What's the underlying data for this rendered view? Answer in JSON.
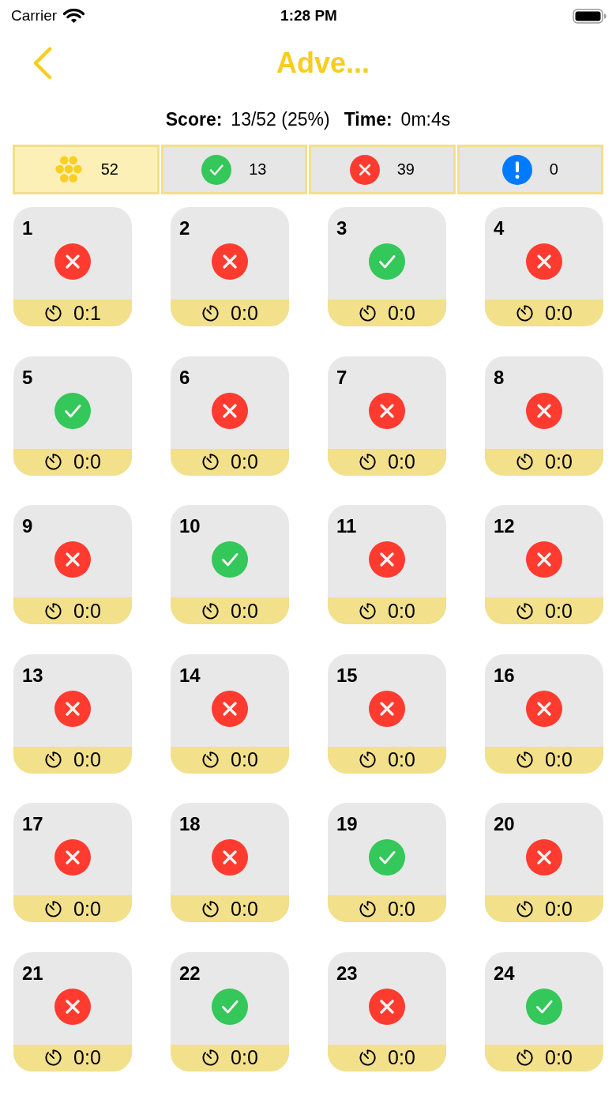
{
  "status_bar": {
    "carrier": "Carrier",
    "time": "1:28 PM"
  },
  "nav": {
    "title": "Adve..."
  },
  "summary": {
    "score_label": "Score:",
    "score_value": "13/52 (25%)",
    "time_label": "Time:",
    "time_value": "0m:4s"
  },
  "filters": [
    {
      "kind": "all",
      "count": "52",
      "selected": true
    },
    {
      "kind": "correct",
      "count": "13",
      "selected": false
    },
    {
      "kind": "wrong",
      "count": "39",
      "selected": false
    },
    {
      "kind": "unanswered",
      "count": "0",
      "selected": false
    }
  ],
  "questions": [
    {
      "number": "1",
      "correct": false,
      "time": "0:1"
    },
    {
      "number": "2",
      "correct": false,
      "time": "0:0"
    },
    {
      "number": "3",
      "correct": true,
      "time": "0:0"
    },
    {
      "number": "4",
      "correct": false,
      "time": "0:0"
    },
    {
      "number": "5",
      "correct": true,
      "time": "0:0"
    },
    {
      "number": "6",
      "correct": false,
      "time": "0:0"
    },
    {
      "number": "7",
      "correct": false,
      "time": "0:0"
    },
    {
      "number": "8",
      "correct": false,
      "time": "0:0"
    },
    {
      "number": "9",
      "correct": false,
      "time": "0:0"
    },
    {
      "number": "10",
      "correct": true,
      "time": "0:0"
    },
    {
      "number": "11",
      "correct": false,
      "time": "0:0"
    },
    {
      "number": "12",
      "correct": false,
      "time": "0:0"
    },
    {
      "number": "13",
      "correct": false,
      "time": "0:0"
    },
    {
      "number": "14",
      "correct": false,
      "time": "0:0"
    },
    {
      "number": "15",
      "correct": false,
      "time": "0:0"
    },
    {
      "number": "16",
      "correct": false,
      "time": "0:0"
    },
    {
      "number": "17",
      "correct": false,
      "time": "0:0"
    },
    {
      "number": "18",
      "correct": false,
      "time": "0:0"
    },
    {
      "number": "19",
      "correct": true,
      "time": "0:0"
    },
    {
      "number": "20",
      "correct": false,
      "time": "0:0"
    },
    {
      "number": "21",
      "correct": false,
      "time": "0:0"
    },
    {
      "number": "22",
      "correct": true,
      "time": "0:0"
    },
    {
      "number": "23",
      "correct": false,
      "time": "0:0"
    },
    {
      "number": "24",
      "correct": true,
      "time": "0:0"
    }
  ]
}
